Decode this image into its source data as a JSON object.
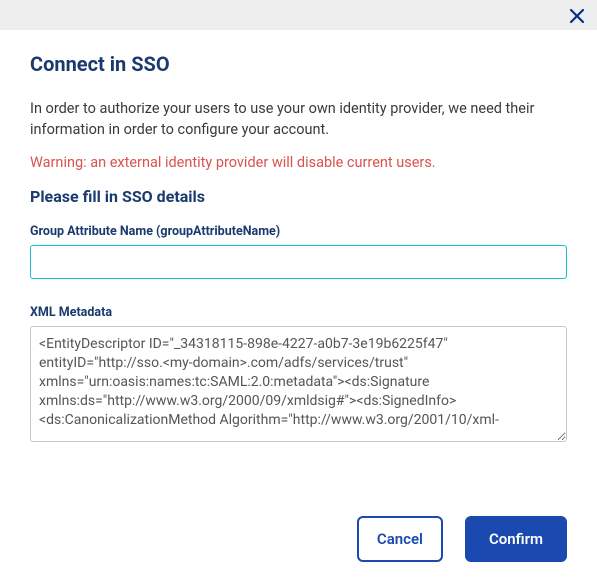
{
  "dialog": {
    "title": "Connect in SSO",
    "intro": "In order to authorize your users to use your own identity provider, we need their information in order to configure your account.",
    "warning": "Warning: an external identity provider will disable current users.",
    "subheading": "Please fill in SSO details"
  },
  "fields": {
    "group_attribute": {
      "label": "Group Attribute Name (groupAttributeName)",
      "value": ""
    },
    "xml_metadata": {
      "label": "XML Metadata",
      "value": "<EntityDescriptor ID=\"_34318115-898e-4227-a0b7-3e19b6225f47\" entityID=\"http://sso.<my-domain>.com/adfs/services/trust\" xmlns=\"urn:oasis:names:tc:SAML:2.0:metadata\"><ds:Signature xmlns:ds=\"http://www.w3.org/2000/09/xmldsig#\"><ds:SignedInfo><ds:CanonicalizationMethod Algorithm=\"http://www.w3.org/2001/10/xml-"
    }
  },
  "buttons": {
    "cancel": "Cancel",
    "confirm": "Confirm"
  }
}
